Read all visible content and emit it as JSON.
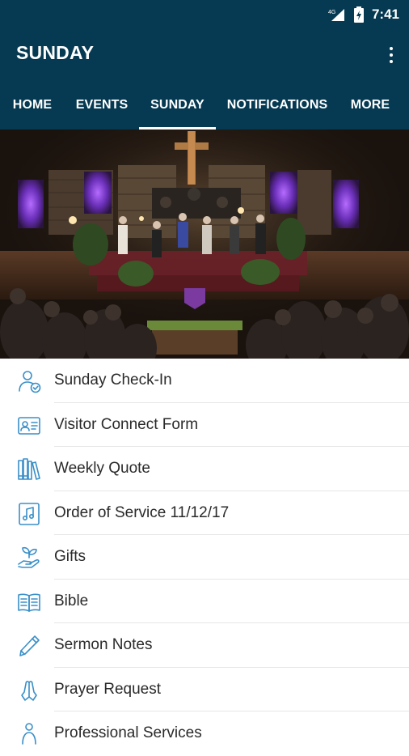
{
  "status": {
    "network": "4G",
    "time": "7:41"
  },
  "appbar": {
    "title": "SUNDAY",
    "menu_icon": "more-vert-icon"
  },
  "tabs": [
    {
      "label": "HOME",
      "active": false
    },
    {
      "label": "EVENTS",
      "active": false
    },
    {
      "label": "SUNDAY",
      "active": true
    },
    {
      "label": "NOTIFICATIONS",
      "active": false
    },
    {
      "label": "MORE",
      "active": false
    }
  ],
  "hero": {
    "alt_icon": "church-stage-photo"
  },
  "menu": [
    {
      "label": "Sunday Check-In",
      "icon": "person-check-icon"
    },
    {
      "label": "Visitor Connect Form",
      "icon": "id-card-icon"
    },
    {
      "label": "Weekly Quote",
      "icon": "books-icon"
    },
    {
      "label": "Order of Service 11/12/17",
      "icon": "music-note-icon"
    },
    {
      "label": "Gifts",
      "icon": "hand-plant-icon"
    },
    {
      "label": "Bible",
      "icon": "open-book-icon"
    },
    {
      "label": "Sermon Notes",
      "icon": "pen-icon"
    },
    {
      "label": "Prayer Request",
      "icon": "praying-hands-icon"
    },
    {
      "label": "Professional Services",
      "icon": "person-icon"
    }
  ],
  "colors": {
    "header": "#063a52",
    "icon_accent": "#3a8fc8"
  }
}
